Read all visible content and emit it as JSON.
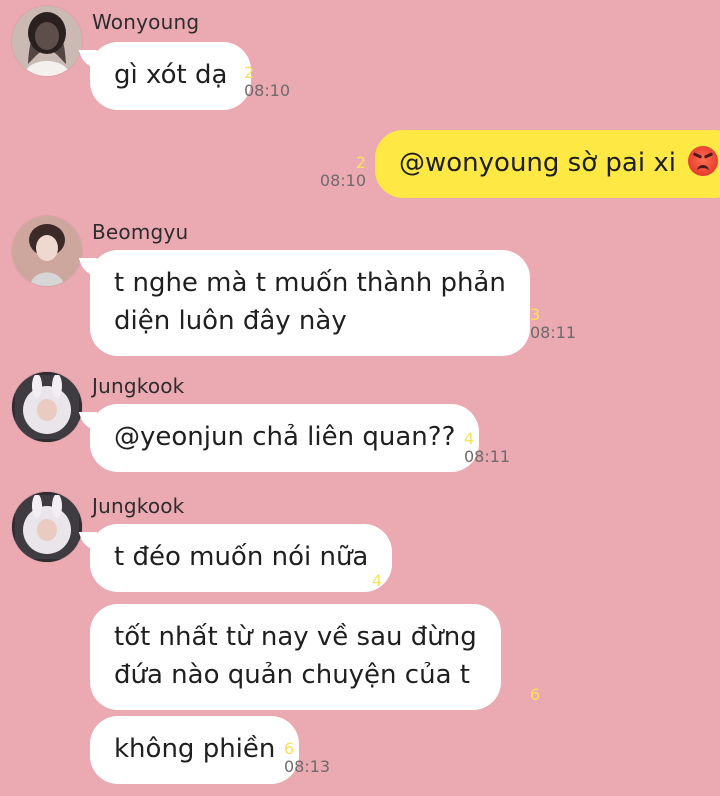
{
  "colors": {
    "background": "#eba9b2",
    "incoming_bubble": "#ffffff",
    "outgoing_bubble": "#fde844",
    "read_count": "#f6e25d",
    "time_text": "#6f6a6b"
  },
  "messages": [
    {
      "sender": "Wonyoung",
      "avatar_icon": "wonyoung-avatar",
      "text": "gì xót dạ",
      "read_count": "2",
      "time": "08:10"
    },
    {
      "sender": "me",
      "text": "@wonyoung sờ pai xi",
      "emoji_icon": "angry-face-icon",
      "read_count": "2",
      "time": "08:10"
    },
    {
      "sender": "Beomgyu",
      "avatar_icon": "beomgyu-avatar",
      "lines": [
        "t nghe mà t muốn thành phản",
        "diện luôn đây này"
      ],
      "read_count": "3",
      "time": "08:11"
    },
    {
      "sender": "Jungkook",
      "avatar_icon": "jungkook-avatar",
      "text": "@yeonjun chả liên quan??",
      "read_count": "4",
      "time": "08:11"
    },
    {
      "sender": "Jungkook",
      "avatar_icon": "jungkook-avatar",
      "text": "t đéo muốn nói nữa",
      "read_count": "4"
    },
    {
      "sender": "Jungkook",
      "lines": [
        "tốt nhất từ nay về sau đừng",
        "đứa nào quản chuyện của t"
      ],
      "read_count": "6"
    },
    {
      "sender": "Jungkook",
      "text": "không phiền",
      "read_count": "6",
      "time": "08:13"
    }
  ]
}
